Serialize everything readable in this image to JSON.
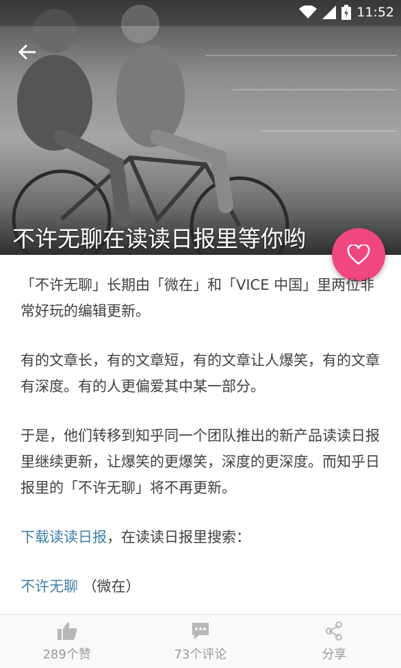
{
  "status_bar": {
    "time": "11:52"
  },
  "hero": {
    "title": "不许无聊在读读日报里等你哟"
  },
  "article": {
    "p1": "「不许无聊」长期由「微在」和「VICE 中国」里两位非常好玩的编辑更新。",
    "p2": "有的文章长，有的文章短，有的文章让人爆笑，有的文章有深度。有的人更偏爱其中某一部分。",
    "p3": "于是，他们转移到知乎同一个团队推出的新产品读读日报里继续更新，让爆笑的更爆笑，深度的更深度。而知乎日报里的「不许无聊」将不再更新。",
    "p4_link": "下载读读日报",
    "p4_text": "，在读读日报里搜索：",
    "p5_link": "不许无聊",
    "p5_text": "（微在）"
  },
  "bottom_bar": {
    "like_label": "289个赞",
    "comment_label": "73个评论",
    "share_label": "分享"
  },
  "colors": {
    "accent": "#f0487e",
    "link": "#3f7ea8"
  },
  "icons": [
    "back-arrow-icon",
    "wifi-icon",
    "signal-icon",
    "battery-icon",
    "heart-icon",
    "thumbs-up-icon",
    "comment-icon",
    "share-icon"
  ]
}
